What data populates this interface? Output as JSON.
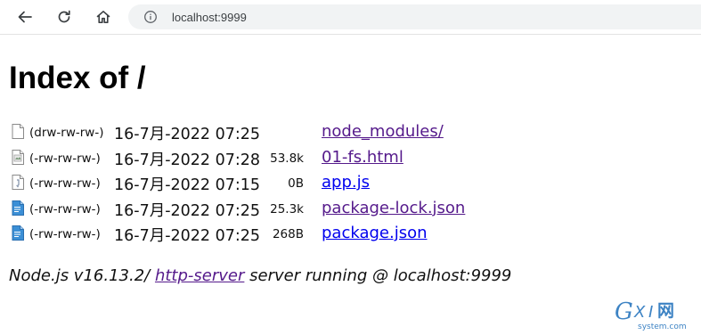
{
  "browser": {
    "url": "localhost:9999"
  },
  "page": {
    "title": "Index of /"
  },
  "entries": [
    {
      "perm": "(drw-rw-rw-)",
      "date": "16-7月-2022 07:25",
      "size": "",
      "name": "node_modules/",
      "icon": "folder-file-icon",
      "visited": true
    },
    {
      "perm": "(-rw-rw-rw-)",
      "date": "16-7月-2022 07:28",
      "size": "53.8k",
      "name": "01-fs.html",
      "icon": "html-file-icon",
      "visited": true
    },
    {
      "perm": "(-rw-rw-rw-)",
      "date": "16-7月-2022 07:15",
      "size": "0B",
      "name": "app.js",
      "icon": "js-file-icon",
      "visited": false
    },
    {
      "perm": "(-rw-rw-rw-)",
      "date": "16-7月-2022 07:25",
      "size": "25.3k",
      "name": "package-lock.json",
      "icon": "json-file-icon",
      "visited": true
    },
    {
      "perm": "(-rw-rw-rw-)",
      "date": "16-7月-2022 07:25",
      "size": "268B",
      "name": "package.json",
      "icon": "json-file-icon",
      "visited": false
    }
  ],
  "footer": {
    "prefix": "Node.js v16.13.2/ ",
    "link": "http-server",
    "suffix": " server running @ localhost:9999"
  },
  "watermark": {
    "brand": "GXI网",
    "domain": "system.com"
  },
  "colors": {
    "visited_link": "#551a8b",
    "unvisited_link": "#0000ee",
    "toolbar_bg": "#ffffff",
    "address_bar_bg": "#f1f3f4"
  }
}
